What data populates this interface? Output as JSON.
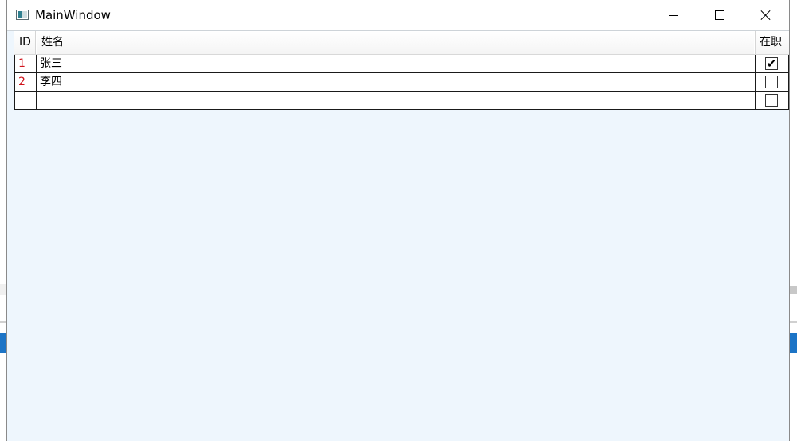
{
  "window": {
    "title": "MainWindow",
    "icon": "app-window-icon",
    "controls": {
      "minimize": "minimize-icon",
      "maximize": "maximize-icon",
      "close": "close-icon"
    }
  },
  "grid": {
    "columns": [
      "ID",
      "姓名",
      "在职"
    ],
    "rows": [
      {
        "id": "1",
        "name": "张三",
        "employed": true
      },
      {
        "id": "2",
        "name": "李四",
        "employed": false
      },
      {
        "id": "",
        "name": "",
        "employed": false
      }
    ],
    "check_glyph": "✔",
    "id_color": "#d0141c"
  }
}
